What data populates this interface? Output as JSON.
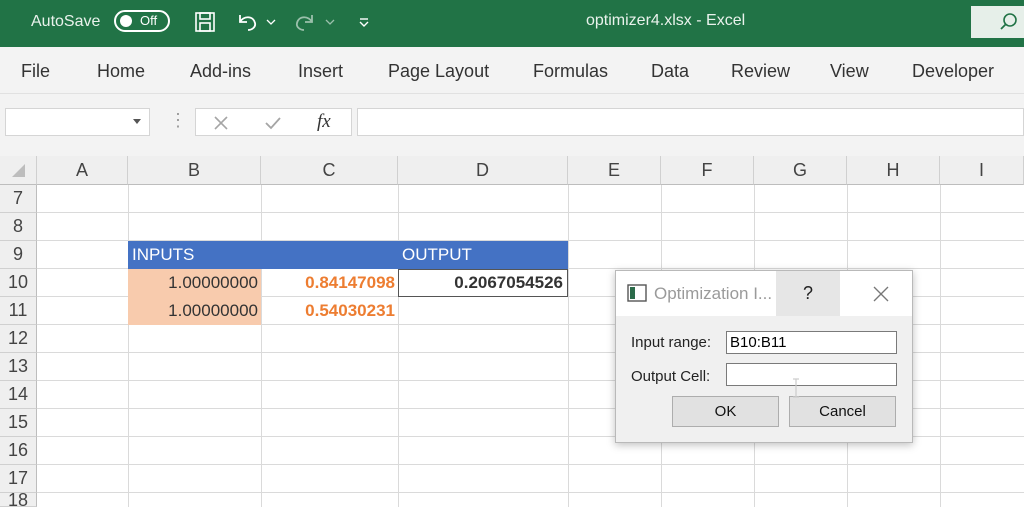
{
  "titlebar": {
    "autosave_label": "AutoSave",
    "autosave_state": "Off",
    "document_title": "optimizer4.xlsx  -  Excel",
    "icons": [
      "save-icon",
      "undo-icon",
      "redo-icon",
      "customize-quick-access-icon",
      "search-icon"
    ]
  },
  "ribbon": {
    "tabs": [
      "File",
      "Home",
      "Add-ins",
      "Insert",
      "Page Layout",
      "Formulas",
      "Data",
      "Review",
      "View",
      "Developer"
    ]
  },
  "formula_bar": {
    "name_box_value": "",
    "fx_label": "fx",
    "formula_value": ""
  },
  "sheet": {
    "columns": [
      "A",
      "B",
      "C",
      "D",
      "E",
      "F",
      "G",
      "H",
      "I"
    ],
    "rows": [
      "7",
      "8",
      "9",
      "10",
      "11",
      "12",
      "13",
      "14",
      "15",
      "16",
      "17",
      "18"
    ],
    "header_inputs": "INPUTS",
    "header_output": "OUTPUT",
    "b10": "1.00000000",
    "b11": "1.00000000",
    "c10": "0.84147098",
    "c11": "0.54030231",
    "d10": "0.2067054526"
  },
  "dialog": {
    "title": "Optimization I...",
    "help": "?",
    "input_range_label": "Input range:",
    "input_range_value": "B10:B11",
    "output_cell_label": "Output Cell:",
    "output_cell_value": "",
    "ok_label": "OK",
    "cancel_label": "Cancel"
  },
  "colors": {
    "excel_green": "#217346",
    "header_blue": "#4472c4",
    "input_fill": "#f8cbad",
    "output_orange": "#ed7d31"
  }
}
